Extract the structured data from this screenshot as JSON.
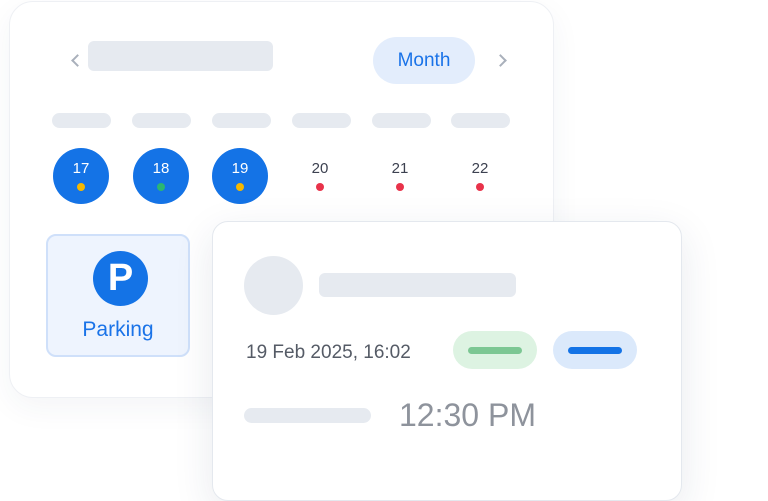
{
  "calendar": {
    "view_label": "Month",
    "days": [
      {
        "num": "17",
        "selected": true,
        "dot_color": "#f5b800"
      },
      {
        "num": "18",
        "selected": true,
        "dot_color": "#2bb673"
      },
      {
        "num": "19",
        "selected": true,
        "dot_color": "#f5b800"
      },
      {
        "num": "20",
        "selected": false,
        "dot_color": "#e8334a"
      },
      {
        "num": "21",
        "selected": false,
        "dot_color": "#e8334a"
      },
      {
        "num": "22",
        "selected": false,
        "dot_color": "#e8334a"
      }
    ],
    "parking": {
      "icon_letter": "P",
      "label": "Parking"
    }
  },
  "detail": {
    "datetime": "19 Feb 2025, 16:02",
    "time": "12:30 PM",
    "colors": {
      "green_pill": "#ddf3e2",
      "green_bar": "#7cc793",
      "blue_pill": "#dbe9fb",
      "blue_bar": "#1473e6"
    }
  }
}
